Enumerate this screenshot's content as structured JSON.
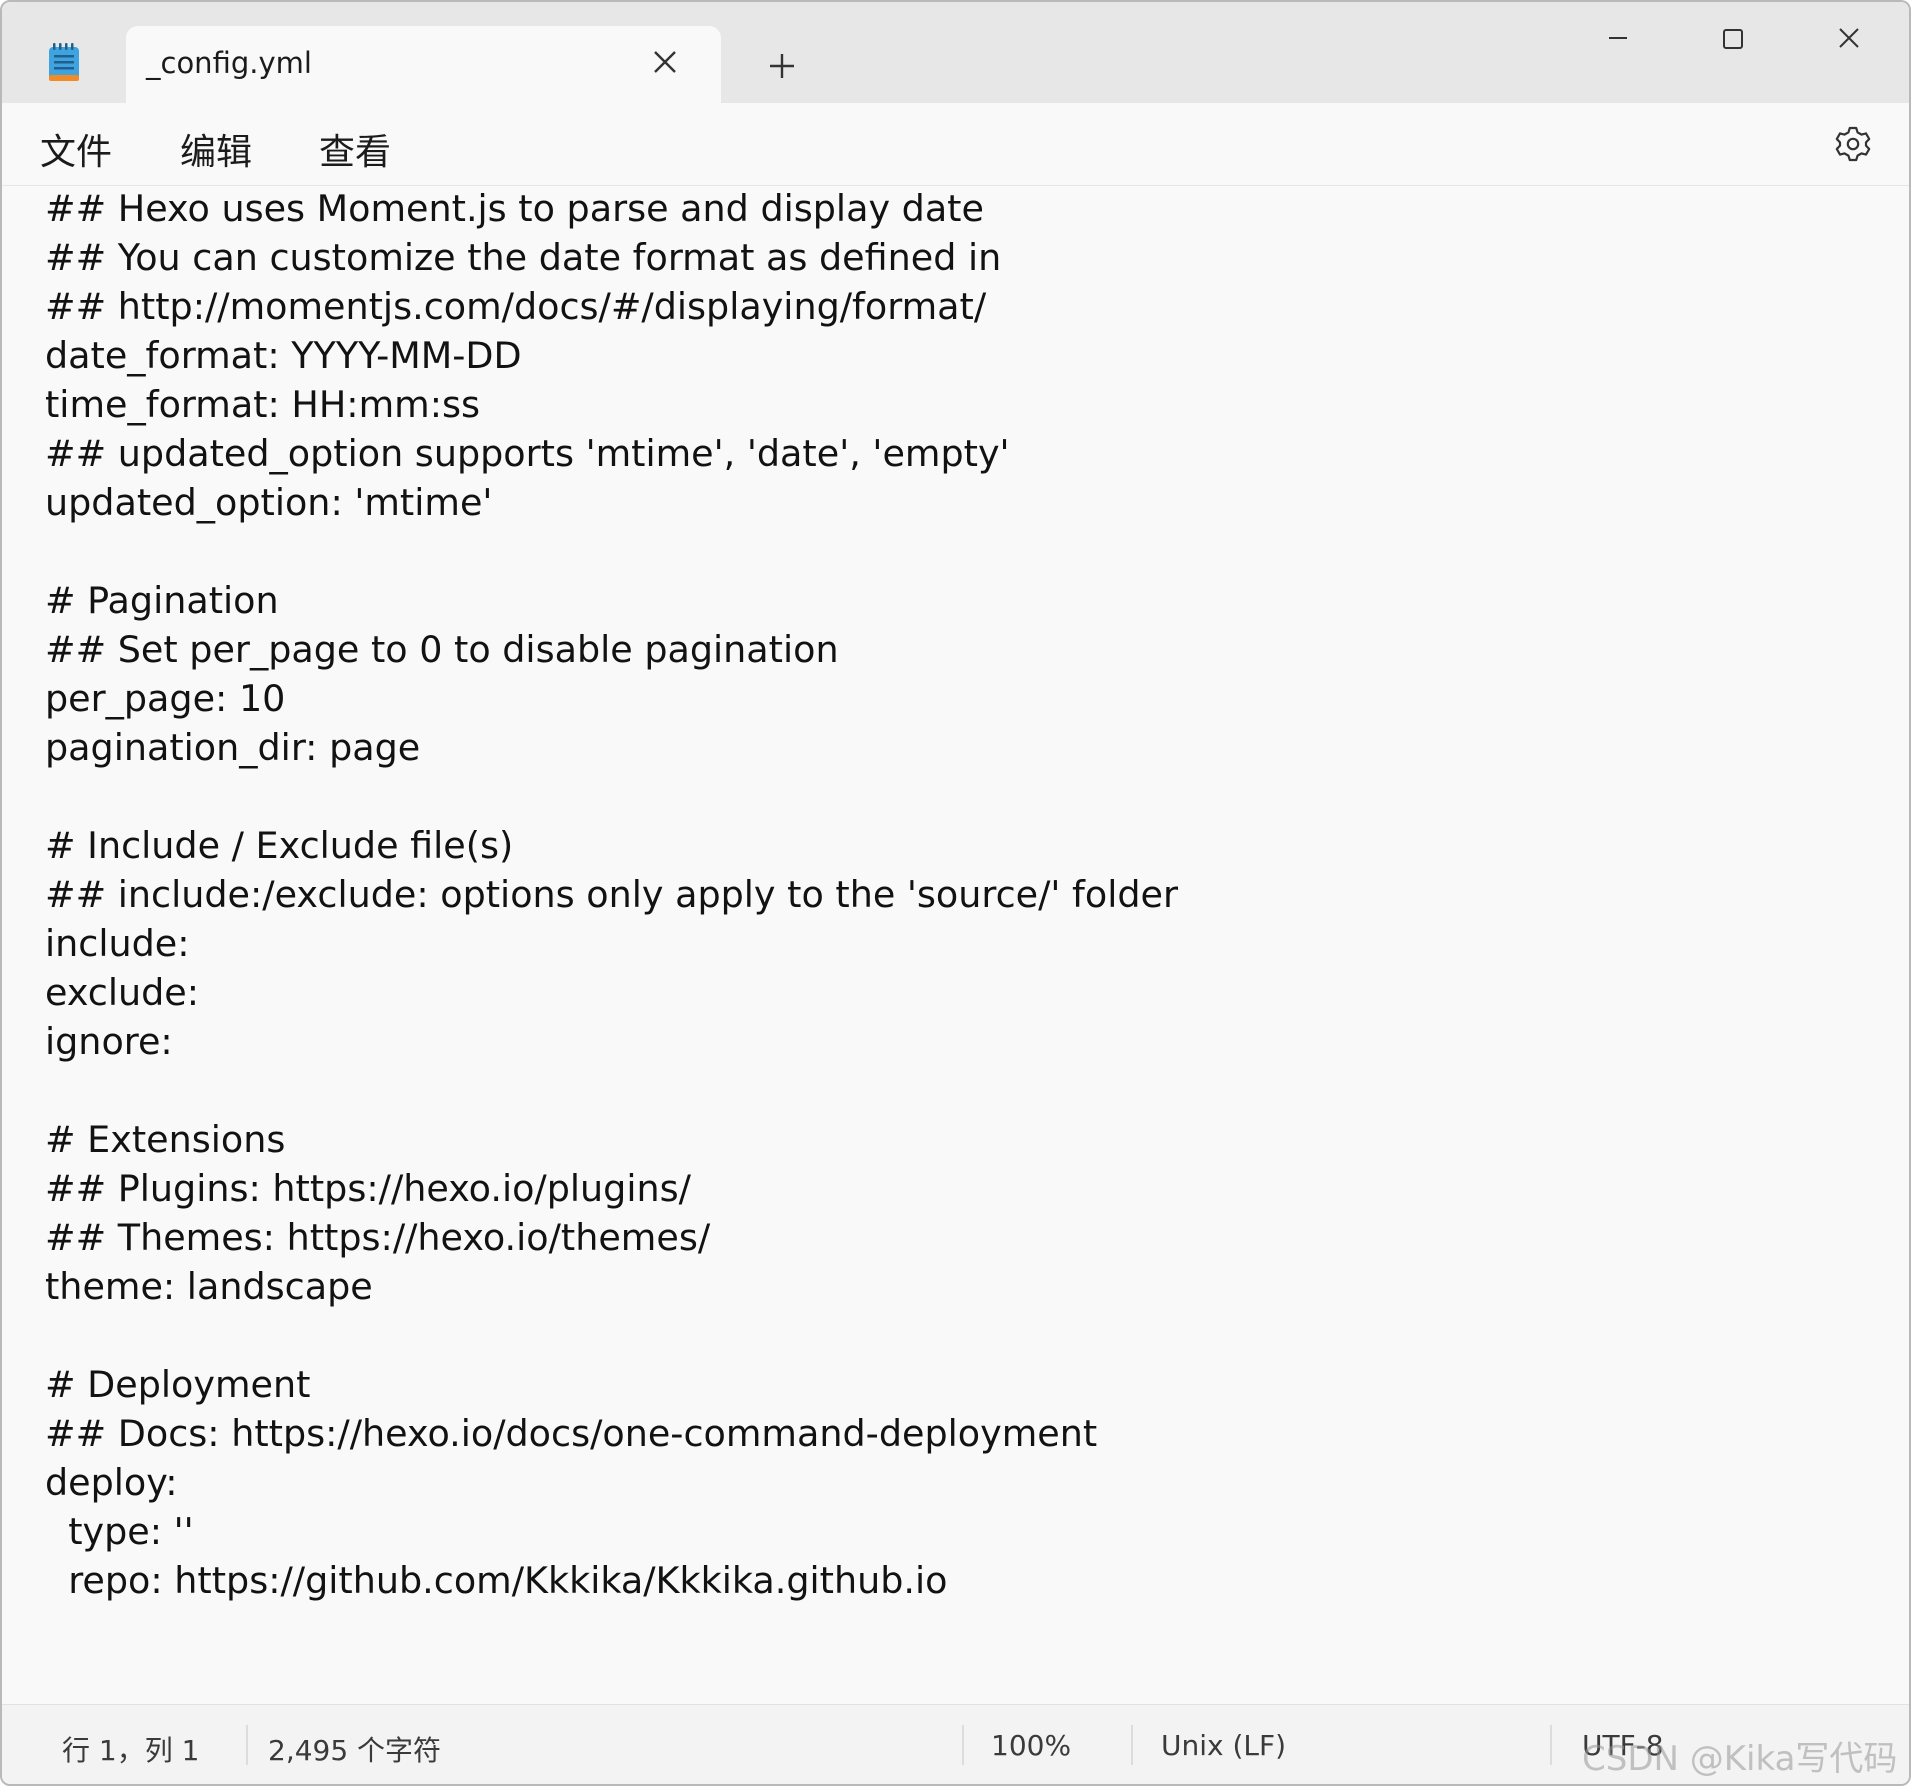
{
  "app": {
    "icon": "notepad-icon"
  },
  "tab": {
    "title": "_config.yml",
    "close_icon": "close-icon"
  },
  "new_tab_icon": "plus-icon",
  "window_controls": {
    "minimize_icon": "minimize-icon",
    "maximize_icon": "maximize-icon",
    "close_icon": "close-icon"
  },
  "menu": {
    "file": "文件",
    "edit": "编辑",
    "view": "查看",
    "settings_icon": "gear-icon"
  },
  "editor": {
    "lines": [
      "## Hexo uses Moment.js to parse and display date",
      "## You can customize the date format as defined in",
      "## http://momentjs.com/docs/#/displaying/format/",
      "date_format: YYYY-MM-DD",
      "time_format: HH:mm:ss",
      "## updated_option supports 'mtime', 'date', 'empty'",
      "updated_option: 'mtime'",
      "",
      "# Pagination",
      "## Set per_page to 0 to disable pagination",
      "per_page: 10",
      "pagination_dir: page",
      "",
      "# Include / Exclude file(s)",
      "## include:/exclude: options only apply to the 'source/' folder",
      "include:",
      "exclude:",
      "ignore:",
      "",
      "# Extensions",
      "## Plugins: https://hexo.io/plugins/",
      "## Themes: https://hexo.io/themes/",
      "theme: landscape",
      "",
      "# Deployment",
      "## Docs: https://hexo.io/docs/one-command-deployment",
      "deploy:",
      "  type: ''",
      "  repo: https://github.com/Kkkika/Kkkika.github.io"
    ]
  },
  "status": {
    "position": "行 1，列 1",
    "char_count": "2,495 个字符",
    "zoom": "100%",
    "line_ending": "Unix (LF)",
    "encoding": "UTF-8",
    "watermark": "CSDN @Kika写代码"
  },
  "colors": {
    "titlebar": "#e7e7e7",
    "editor_bg": "#f9f9f9",
    "icon_blue": "#3fa3e0",
    "icon_orange": "#f28a28"
  }
}
